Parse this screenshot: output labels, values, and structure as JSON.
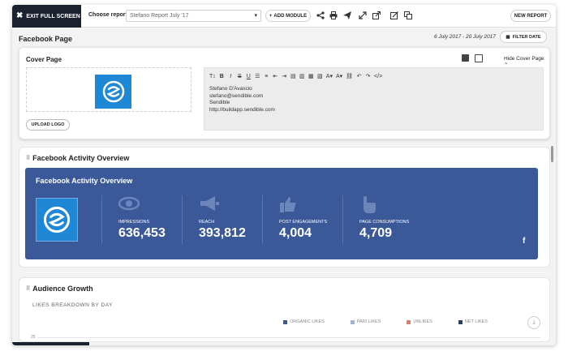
{
  "topbar": {
    "exit_label": "EXIT FULL SCREEN",
    "choose_label": "Choose report",
    "report_value": "Stefano Report July '17",
    "add_module_label": "ADD MODULE",
    "new_report_label": "NEW REPORT",
    "tools": [
      "share-icon",
      "print-icon",
      "send-icon",
      "expand-icon",
      "external-link-icon",
      "edit-icon",
      "copy-icon"
    ]
  },
  "page": {
    "title": "Facebook Page",
    "date_range": "6 July 2017 - 20 July 2017",
    "filter_label": "FILTER DATE"
  },
  "cover": {
    "title": "Cover Page",
    "hide_label": "Hide Cover Page",
    "upload_label": "UPLOAD LOGO",
    "editor_lines": [
      "Stefano D'Avascio",
      "stefano@sendible.com",
      "Sendible",
      "http://buildapp.sendible.com"
    ]
  },
  "activity": {
    "section_title": "Facebook Activity Overview",
    "panel_title": "Facebook Activity Overview",
    "metrics": [
      {
        "label": "IMPRESSIONS",
        "value": "636,453",
        "icon": "eye-icon"
      },
      {
        "label": "REACH",
        "value": "393,812",
        "icon": "megaphone-icon"
      },
      {
        "label": "POST ENGAGEMENTS",
        "value": "4,004",
        "icon": "thumbs-up-icon"
      },
      {
        "label": "PAGE CONSUMPTIONS",
        "value": "4,709",
        "icon": "hand-pointer-icon"
      }
    ],
    "brand_color": "#3b5998"
  },
  "audience": {
    "title": "Audience Growth",
    "subtitle": "LIKES BREAKDOWN BY DAY",
    "y_tick": "25",
    "legend": [
      {
        "label": "ORGANIC LIKES",
        "color": "#3b5998"
      },
      {
        "label": "PAID LIKES",
        "color": "#a4b3d6"
      },
      {
        "label": "UNLIKES",
        "color": "#e07a6a"
      },
      {
        "label": "NET LIKES",
        "color": "#2a3f6e"
      }
    ]
  }
}
